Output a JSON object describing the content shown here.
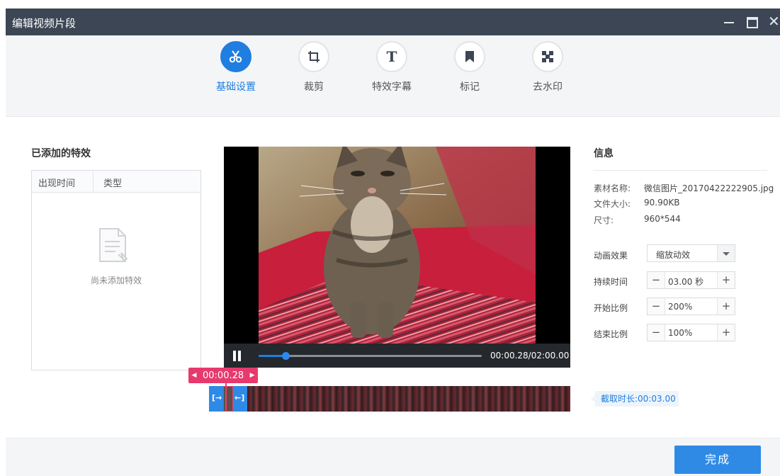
{
  "window": {
    "title": "编辑视频片段"
  },
  "toolbar": {
    "items": [
      {
        "label": "基础设置",
        "icon": "scissors-icon",
        "active": true
      },
      {
        "label": "裁剪",
        "icon": "crop-icon",
        "active": false
      },
      {
        "label": "特效字幕",
        "icon": "text-icon",
        "active": false
      },
      {
        "label": "标记",
        "icon": "bookmark-icon",
        "active": false
      },
      {
        "label": "去水印",
        "icon": "remove-watermark-icon",
        "active": false
      }
    ]
  },
  "effects": {
    "title": "已添加的特效",
    "columns": [
      "出现时间",
      "类型"
    ],
    "empty_text": "尚未添加特效"
  },
  "player": {
    "timecode": "00:00.28/02:00.00",
    "progress": 0.12
  },
  "timeline": {
    "marker_time": "00:00.28"
  },
  "info": {
    "title": "信息",
    "rows": [
      {
        "label": "素材名称:",
        "value": "微信图片_20170422222905.jpg"
      },
      {
        "label": "文件大小:",
        "value": "90.90KB"
      },
      {
        "label": "尺寸:",
        "value": "960*544"
      }
    ],
    "animation": {
      "label": "动画效果",
      "value": "缩放动效"
    },
    "duration": {
      "label": "持续时间",
      "value": "03.00 秒"
    },
    "start_scale": {
      "label": "开始比例",
      "value": "200%"
    },
    "end_scale": {
      "label": "结束比例",
      "value": "100%"
    },
    "clip_duration": "截取时长:00:03.00"
  },
  "footer": {
    "done_label": "完成"
  },
  "colors": {
    "accent": "#1f7ee0",
    "marker": "#e73a6c",
    "titlebar": "#3c4654"
  }
}
